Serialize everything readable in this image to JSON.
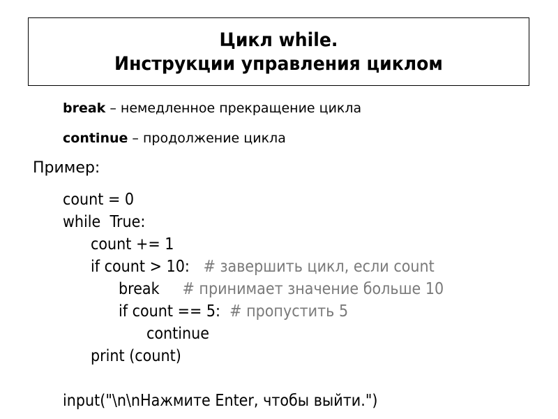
{
  "title": {
    "line1": "Цикл while.",
    "line2": "Инструкции управления циклом"
  },
  "bullets": [
    {
      "keyword": "break",
      "description": " – немедленное прекращение цикла"
    },
    {
      "keyword": "continue",
      "description": " – продолжение цикла"
    }
  ],
  "example_label": "Пример:",
  "code": [
    {
      "code": "count = 0",
      "comment": ""
    },
    {
      "code": "while  True:",
      "comment": ""
    },
    {
      "code": "count += 1",
      "comment": ""
    },
    {
      "code": "if count > 10:   ",
      "comment": "# завершить цикл, если count"
    },
    {
      "code": "break     ",
      "comment": "# принимает значение больше 10"
    },
    {
      "code": "if count == 5:  ",
      "comment": "# пропустить 5"
    },
    {
      "code": "continue",
      "comment": ""
    },
    {
      "code": "print (count)",
      "comment": ""
    },
    {
      "code": "",
      "comment": ""
    },
    {
      "code": "input(\"\\n\\nНажмите Enter, чтобы выйти.\")",
      "comment": ""
    }
  ]
}
